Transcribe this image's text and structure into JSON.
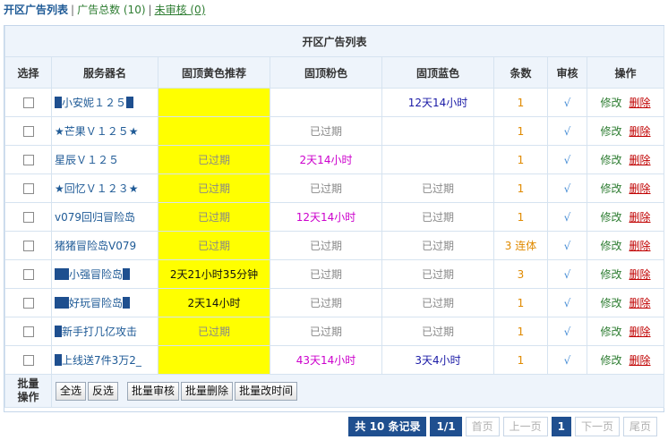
{
  "nav": {
    "current": "开区广告列表",
    "total": "广告总数 (10)",
    "unreviewed": "未审核 (0)"
  },
  "table": {
    "title": "开区广告列表",
    "headers": [
      "选择",
      "服务器名",
      "固顶黄色推荐",
      "固顶粉色",
      "固顶蓝色",
      "条数",
      "审核",
      "操作"
    ],
    "rows": [
      {
        "name": "小安妮１２５",
        "yellow": "",
        "pink": "",
        "blue": "12天14小时",
        "count": "1"
      },
      {
        "name": "★芒果Ｖ１２５★",
        "yellow": "",
        "pink": "已过期",
        "blue": "",
        "count": "1"
      },
      {
        "name": "星辰Ｖ１２５",
        "yellow": "已过期",
        "pink": "2天14小时",
        "blue": "",
        "count": "1"
      },
      {
        "name": "★回忆Ｖ１２３★",
        "yellow": "已过期",
        "pink": "已过期",
        "blue": "已过期",
        "count": "1"
      },
      {
        "name": "v079回归冒险岛",
        "yellow": "已过期",
        "pink": "12天14小时",
        "blue": "已过期",
        "count": "1"
      },
      {
        "name": "猪猪冒险岛V079",
        "yellow": "已过期",
        "pink": "已过期",
        "blue": "已过期",
        "count": "3 连体"
      },
      {
        "name": "小强冒险岛",
        "yellow": "2天21小时35分钟",
        "pink": "已过期",
        "blue": "已过期",
        "count": "3"
      },
      {
        "name": "好玩冒险岛",
        "yellow": "2天14小时",
        "pink": "已过期",
        "blue": "已过期",
        "count": "1"
      },
      {
        "name": "新手打几亿攻击",
        "yellow": "已过期",
        "pink": "已过期",
        "blue": "已过期",
        "count": "1"
      },
      {
        "name": "上线送7件3万2_",
        "yellow": "",
        "pink": "43天14小时",
        "blue": "3天4小时",
        "count": "1"
      }
    ],
    "review_mark": "√",
    "edit_label": "修改",
    "delete_label": "删除"
  },
  "batch": {
    "label": "批量操作",
    "select_all": "全选",
    "invert": "反选",
    "batch_review": "批量审核",
    "batch_delete": "批量删除",
    "batch_time": "批量改时间"
  },
  "pager": {
    "records": "共 10 条记录",
    "pages": "1/1",
    "first": "首页",
    "prev": "上一页",
    "current": "1",
    "next": "下一页",
    "last": "尾页"
  }
}
